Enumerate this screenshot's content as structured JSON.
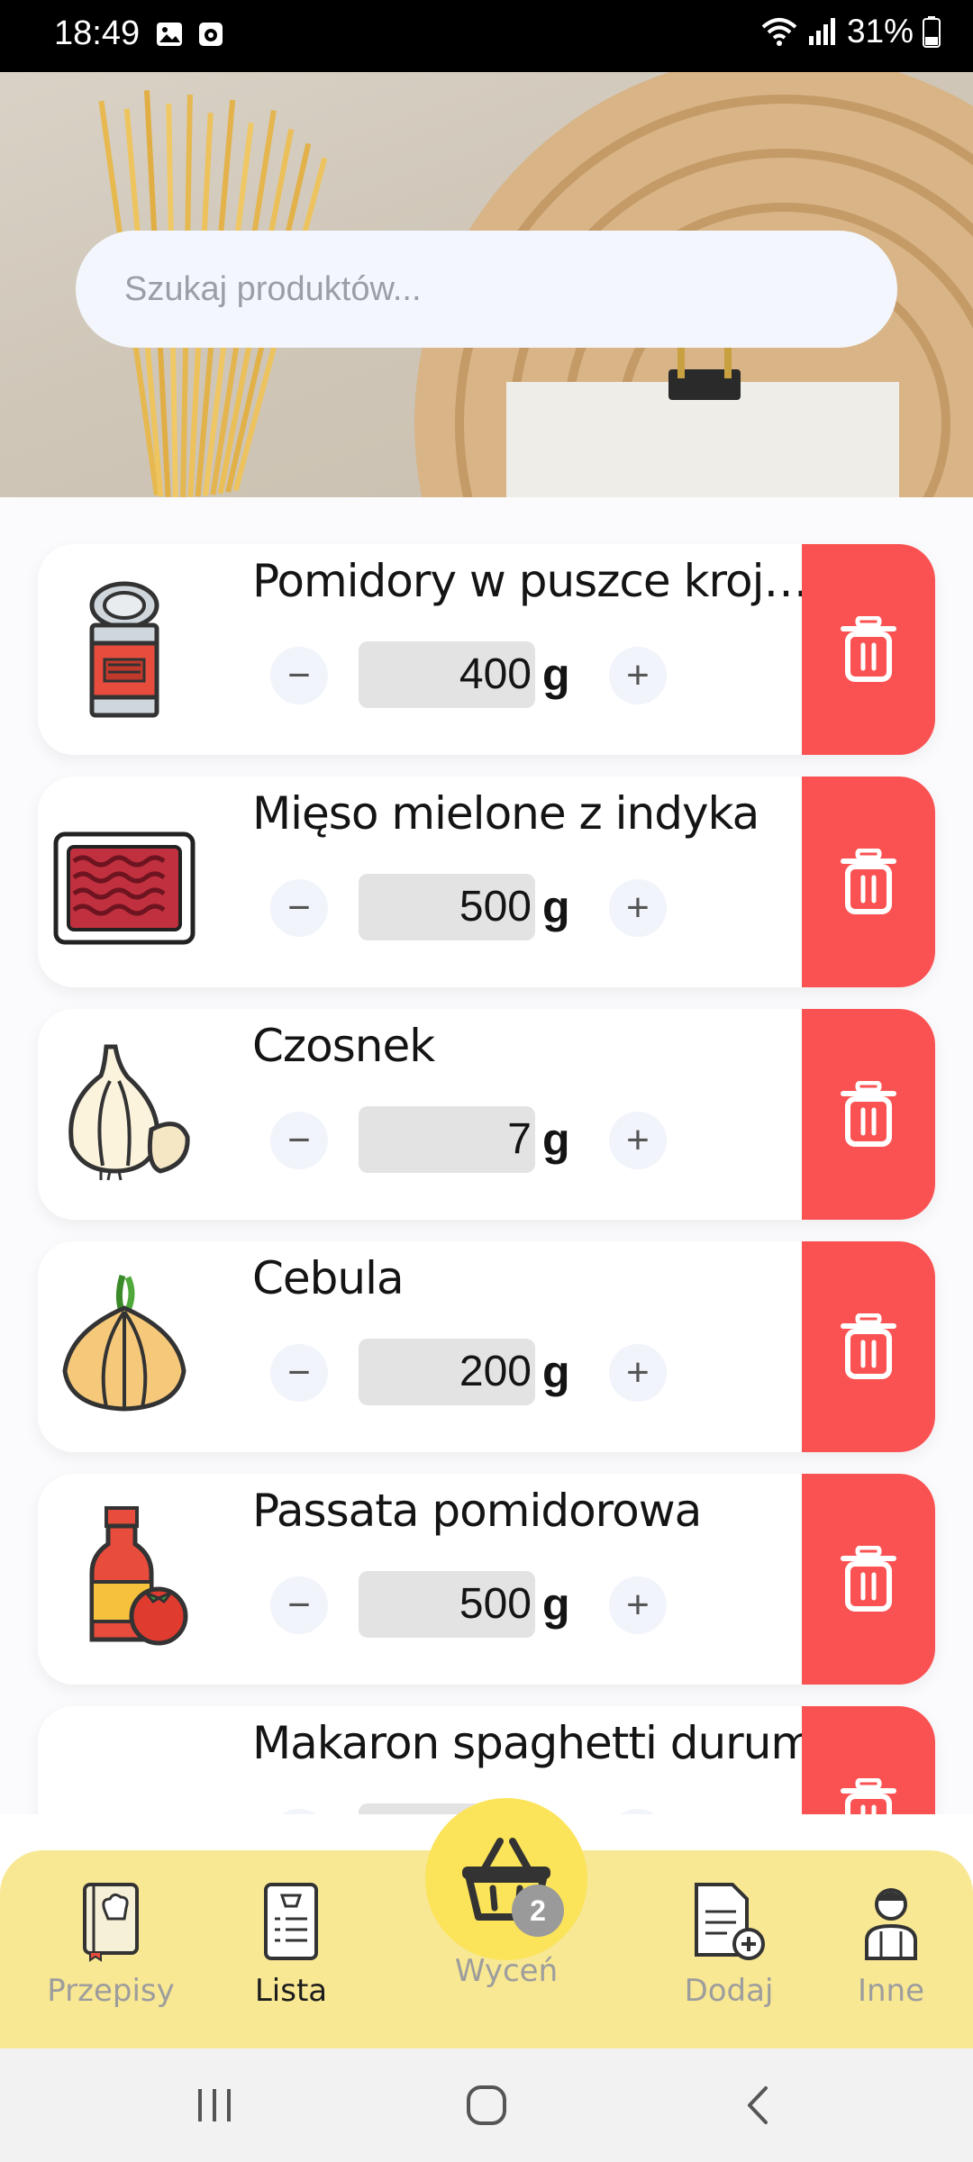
{
  "status_bar": {
    "time": "18:49",
    "battery": "31%",
    "icons": [
      "gallery-icon",
      "screen-record-icon",
      "wifi-icon",
      "signal-icon",
      "battery-icon"
    ]
  },
  "search": {
    "placeholder": "Szukaj produktów..."
  },
  "items": [
    {
      "name": "Pomidory w puszce krojo...",
      "quantity": "400",
      "unit": "g",
      "icon": "canned-tomatoes-icon"
    },
    {
      "name": "Mięso mielone z indyka",
      "quantity": "500",
      "unit": "g",
      "icon": "minced-meat-icon"
    },
    {
      "name": "Czosnek",
      "quantity": "7",
      "unit": "g",
      "icon": "garlic-icon"
    },
    {
      "name": "Cebula",
      "quantity": "200",
      "unit": "g",
      "icon": "onion-icon"
    },
    {
      "name": "Passata pomidorowa",
      "quantity": "500",
      "unit": "g",
      "icon": "passata-icon"
    },
    {
      "name": "Makaron spaghetti durum",
      "quantity": "",
      "unit": "",
      "icon": "pasta-icon"
    }
  ],
  "controls": {
    "minus": "−",
    "plus": "+"
  },
  "bottom_nav": {
    "items": [
      {
        "label": "Przepisy",
        "icon": "recipe-book-icon",
        "active": false
      },
      {
        "label": "Lista",
        "icon": "shopping-list-icon",
        "active": true
      },
      {
        "label": "Dodaj",
        "icon": "add-document-icon",
        "active": false
      },
      {
        "label": "Inne",
        "icon": "person-icon",
        "active": false
      }
    ],
    "fab": {
      "label": "Wyceń",
      "badge": "2",
      "icon": "basket-icon"
    }
  },
  "colors": {
    "delete": "#fa5252",
    "nav_bg": "#f8e793",
    "fab": "#fbe45a",
    "search_bg": "#f3f6fd"
  }
}
